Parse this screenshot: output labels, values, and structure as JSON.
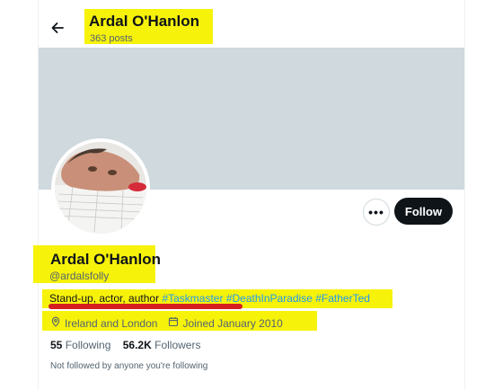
{
  "header": {
    "title": "Ardal O'Hanlon",
    "posts": "363 posts"
  },
  "profile": {
    "name": "Ardal O'Hanlon",
    "handle": "@ardalsfolly",
    "bio_text": "Stand-up, actor, author",
    "hashtags": [
      "#Taskmaster",
      "#DeathInParadise",
      "#FatherTed"
    ],
    "location": "Ireland and London",
    "joined": "Joined January 2010",
    "following_count": "55",
    "following_label": "Following",
    "followers_count": "56.2K",
    "followers_label": "Followers",
    "mutuals_note": "Not followed by anyone you're following"
  },
  "actions": {
    "more_label": "•••",
    "follow_label": "Follow"
  },
  "icons": {
    "back": "arrow-left-icon",
    "location": "location-pin-icon",
    "calendar": "calendar-icon"
  },
  "colors": {
    "highlight": "#f7f20a",
    "underline": "#d61f1f",
    "hashtag": "#1d9bf0",
    "banner": "#cfd9de",
    "button": "#0f1419"
  }
}
